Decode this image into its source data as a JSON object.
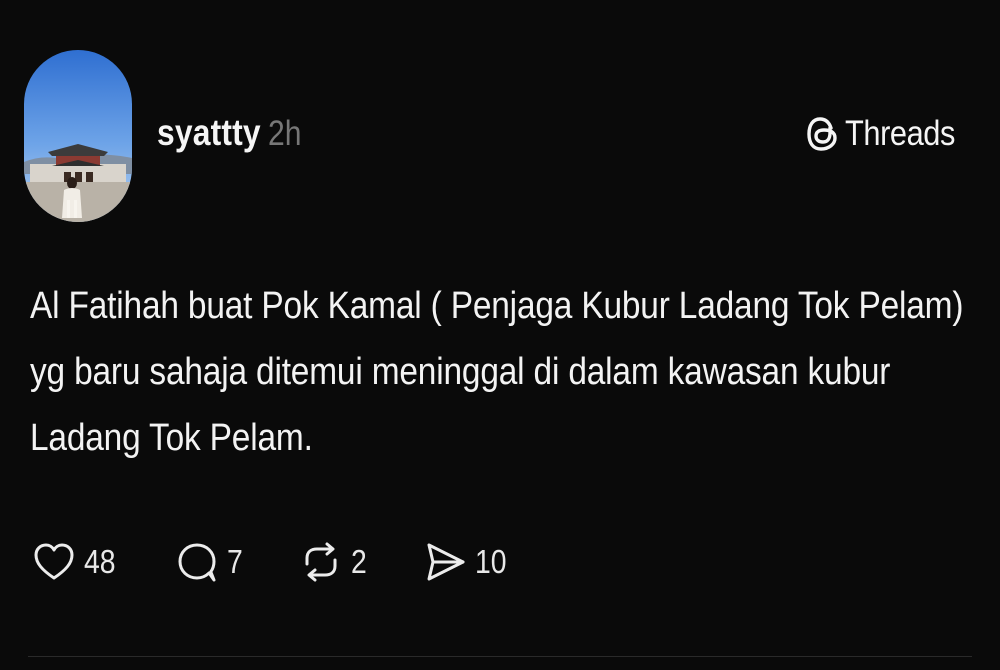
{
  "post": {
    "username": "syattty",
    "timestamp": "2h",
    "brand": {
      "name": "Threads",
      "icon": "threads-logo-icon"
    },
    "text_lines": [
      "Al Fatihah buat Pok Kamal ( Penjaga Kubur Ladang Tok Pelam)",
      "yg baru sahaja ditemui meninggal di dalam kawasan kubur",
      "Ladang Tok Pelam."
    ],
    "actions": [
      {
        "icon": "heart-icon",
        "count": "48"
      },
      {
        "icon": "comment-icon",
        "count": "7"
      },
      {
        "icon": "repost-icon",
        "count": "2"
      },
      {
        "icon": "share-icon",
        "count": "10"
      }
    ]
  },
  "colors": {
    "background": "#0a0a0a",
    "text": "#f3f3f3",
    "muted": "#777777"
  }
}
